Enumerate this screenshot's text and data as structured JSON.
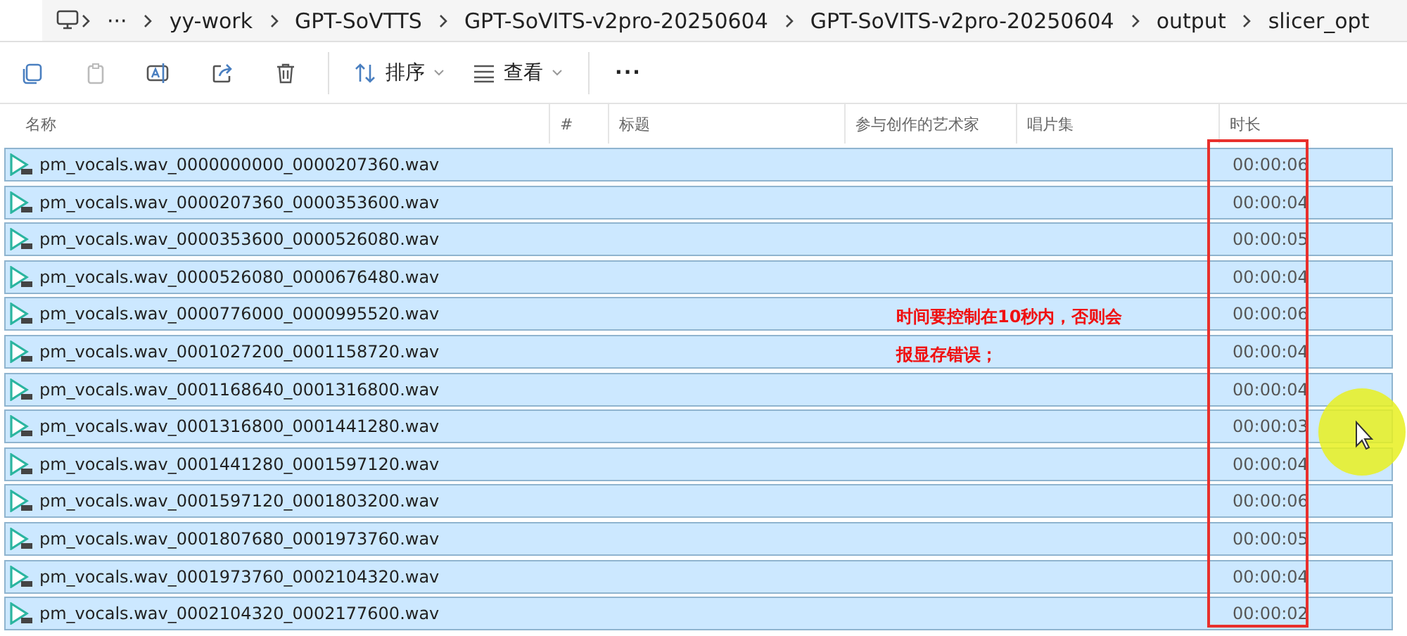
{
  "breadcrumbs": [
    "···",
    "yy-work",
    "GPT-SoVTTS",
    "GPT-SoVITS-v2pro-20250604",
    "GPT-SoVITS-v2pro-20250604",
    "output",
    "slicer_opt"
  ],
  "toolbar": [
    {
      "kind": "copy",
      "disabled": false
    },
    {
      "kind": "paste",
      "disabled": true
    },
    {
      "kind": "rename",
      "disabled": false
    },
    {
      "kind": "share",
      "disabled": false
    },
    {
      "kind": "delete",
      "disabled": false
    },
    {
      "kind": "sort",
      "label": "排序",
      "disabled": false
    },
    {
      "kind": "view",
      "label": "查看",
      "disabled": false
    },
    {
      "kind": "more",
      "label": "···",
      "disabled": false
    }
  ],
  "columns": [
    "名称",
    "#",
    "标题",
    "参与创作的艺术家",
    "唱片集",
    "时长"
  ],
  "rows": [
    {
      "name": "pm_vocals.wav_0000000000_0000207360.wav",
      "duration": "00:00:06",
      "selected": true
    },
    {
      "name": "pm_vocals.wav_0000207360_0000353600.wav",
      "duration": "00:00:04",
      "selected": true
    },
    {
      "name": "pm_vocals.wav_0000353600_0000526080.wav",
      "duration": "00:00:05",
      "selected": true
    },
    {
      "name": "pm_vocals.wav_0000526080_0000676480.wav",
      "duration": "00:00:04",
      "selected": true
    },
    {
      "name": "pm_vocals.wav_0000776000_0000995520.wav",
      "duration": "00:00:06",
      "selected": true,
      "note": "时间要控制在10秒内，否则会"
    },
    {
      "name": "pm_vocals.wav_0001027200_0001158720.wav",
      "duration": "00:00:04",
      "selected": true,
      "note": "报显存错误；"
    },
    {
      "name": "pm_vocals.wav_0001168640_0001316800.wav",
      "duration": "00:00:04",
      "selected": true
    },
    {
      "name": "pm_vocals.wav_0001316800_0001441280.wav",
      "duration": "00:00:03",
      "selected": true
    },
    {
      "name": "pm_vocals.wav_0001441280_0001597120.wav",
      "duration": "00:00:04",
      "selected": true
    },
    {
      "name": "pm_vocals.wav_0001597120_0001803200.wav",
      "duration": "00:00:06",
      "selected": true
    },
    {
      "name": "pm_vocals.wav_0001807680_0001973760.wav",
      "duration": "00:00:05",
      "selected": true
    },
    {
      "name": "pm_vocals.wav_0001973760_0002104320.wav",
      "duration": "00:00:04",
      "selected": true
    },
    {
      "name": "pm_vocals.wav_0002104320_0002177600.wav",
      "duration": "00:00:02",
      "selected": true
    }
  ]
}
